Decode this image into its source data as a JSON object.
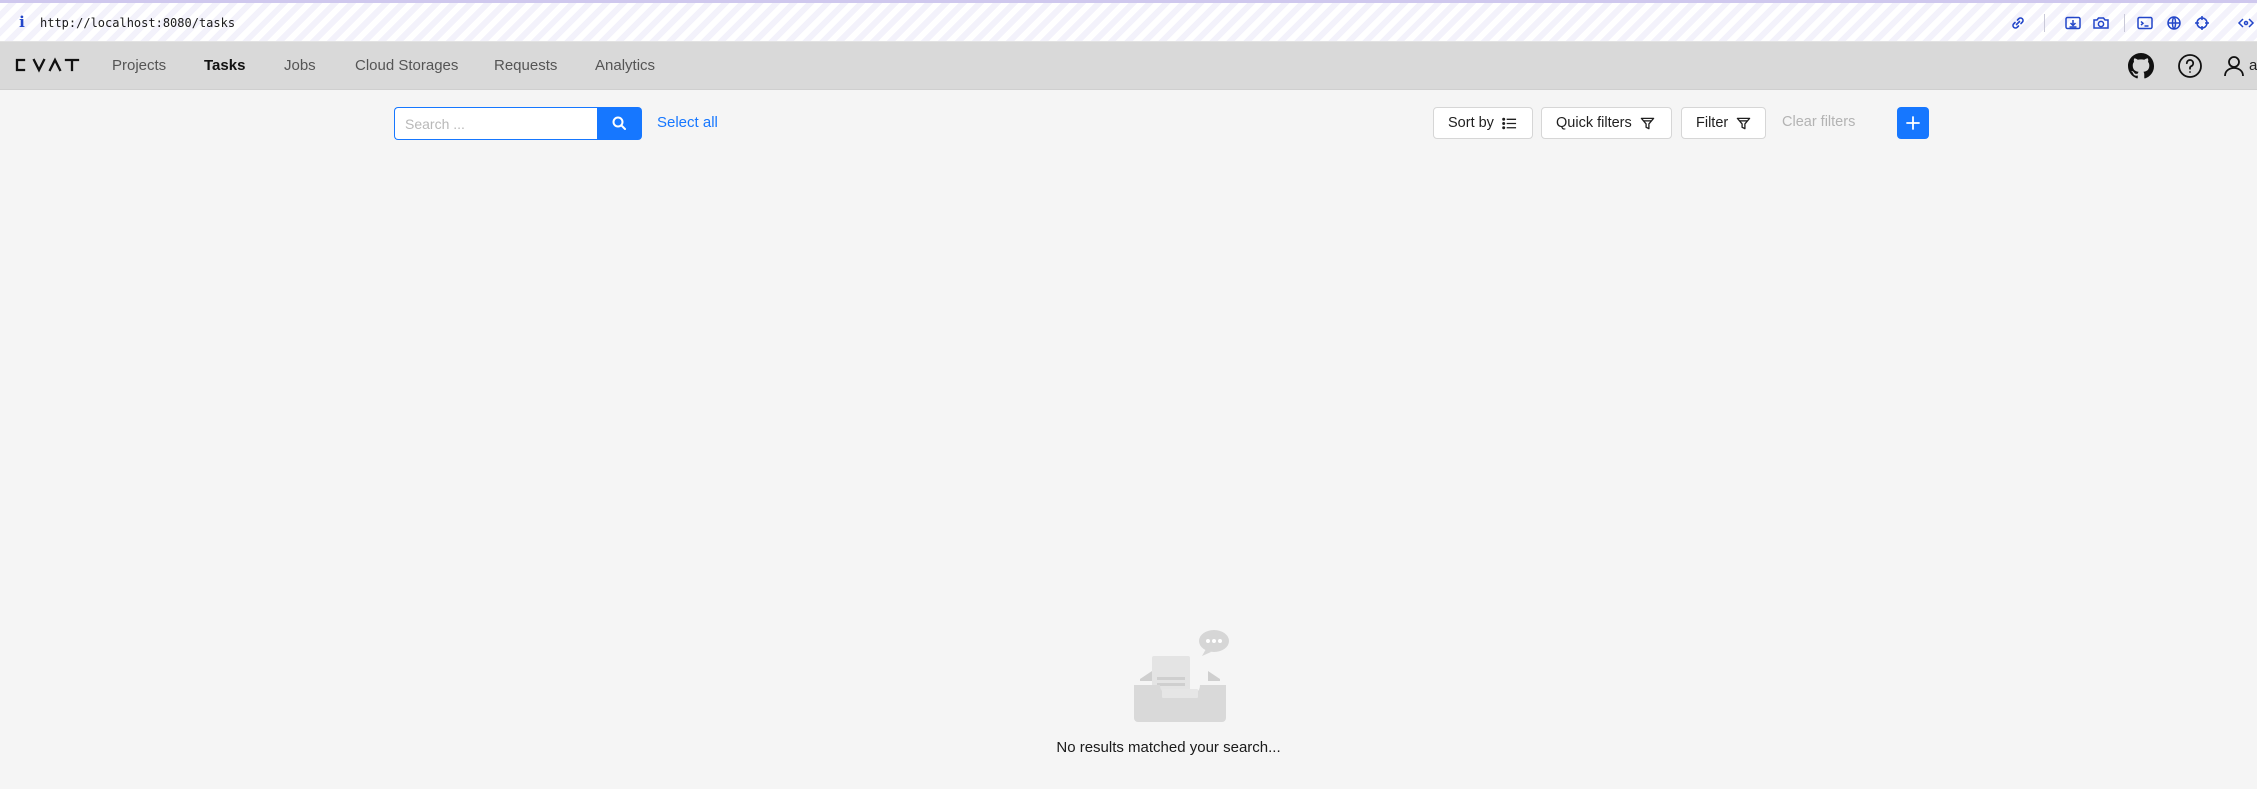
{
  "browser": {
    "url": "http://localhost:8080/tasks",
    "info_icon": "info-icon",
    "toolbar_icons": [
      "link-icon",
      "download-icon",
      "camera-icon",
      "terminal-icon",
      "globe-icon",
      "crosshair-icon",
      "code-icon"
    ]
  },
  "header": {
    "logo_text": "CVAT",
    "nav": [
      {
        "label": "Projects",
        "active": false
      },
      {
        "label": "Tasks",
        "active": true
      },
      {
        "label": "Jobs",
        "active": false
      },
      {
        "label": "Cloud Storages",
        "active": false
      },
      {
        "label": "Requests",
        "active": false
      },
      {
        "label": "Analytics",
        "active": false
      }
    ],
    "right_icons": [
      "github-icon",
      "help-icon",
      "user-icon"
    ],
    "user_initial": "a"
  },
  "toolbar": {
    "search_placeholder": "Search ...",
    "search_value": "",
    "select_all": "Select all",
    "sort_by": "Sort by",
    "quick_filters": "Quick filters",
    "filter": "Filter",
    "clear_filters": "Clear filters"
  },
  "empty_state": {
    "message": "No results matched your search..."
  },
  "colors": {
    "primary": "#1677ff",
    "header_bg": "#d9d9d9",
    "page_bg": "#f5f5f5",
    "disabled_text": "#b3b3b3"
  }
}
